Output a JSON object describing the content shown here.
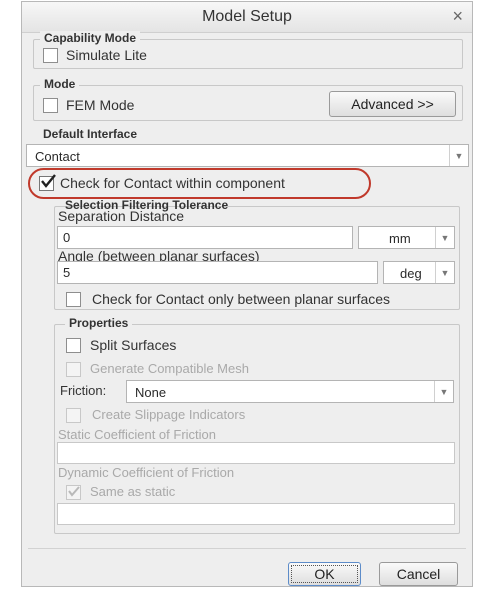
{
  "dialog": {
    "title": "Model Setup",
    "close_glyph": "×"
  },
  "capability": {
    "legend": "Capability Mode",
    "simulate_lite": "Simulate Lite"
  },
  "mode": {
    "legend": "Mode",
    "fem_mode": "FEM Mode",
    "advanced_button": "Advanced >>"
  },
  "default_interface": {
    "legend": "Default Interface",
    "selected": "Contact",
    "check_contact_label": "Check for Contact within component",
    "check_contact_checked": true
  },
  "selection_filtering": {
    "legend": "Selection Filtering Tolerance",
    "separation_label": "Separation Distance",
    "separation_value": "0",
    "separation_unit": "mm",
    "angle_label": "Angle (between planar surfaces)",
    "angle_value": "5",
    "angle_unit": "deg",
    "planar_only_label": "Check for Contact only between planar surfaces"
  },
  "properties": {
    "legend": "Properties",
    "split_surfaces": "Split Surfaces",
    "generate_mesh": "Generate Compatible Mesh",
    "friction_label": "Friction:",
    "friction_value": "None",
    "slippage": "Create Slippage Indicators",
    "static_coef_label": "Static Coefficient of Friction",
    "dynamic_coef_label": "Dynamic Coefficient of Friction",
    "same_as_static": "Same as static"
  },
  "buttons": {
    "ok": "OK",
    "cancel": "Cancel"
  },
  "colors": {
    "highlight": "#c0392b",
    "dialog_bg": "#eeeeee"
  }
}
